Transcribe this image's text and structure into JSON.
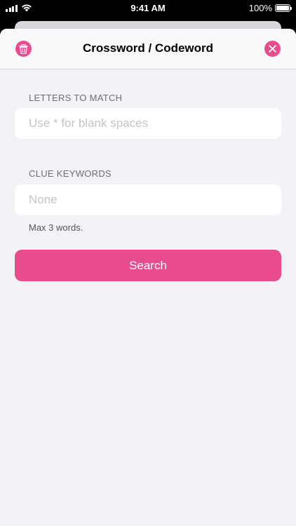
{
  "status_bar": {
    "time": "9:41 AM",
    "battery_percent": "100%",
    "battery_level": 1.0
  },
  "header": {
    "title": "Crossword / Codeword",
    "left_icon": "trash-icon",
    "right_icon": "close-icon"
  },
  "letters": {
    "label": "LETTERS TO MATCH",
    "value": "",
    "placeholder": "Use * for blank spaces"
  },
  "keywords": {
    "label": "CLUE KEYWORDS",
    "value": "",
    "placeholder": "None",
    "hint": "Max 3 words."
  },
  "search_button": {
    "label": "Search"
  },
  "colors": {
    "accent": "#e94c8e",
    "background": "#f2f2f7"
  }
}
